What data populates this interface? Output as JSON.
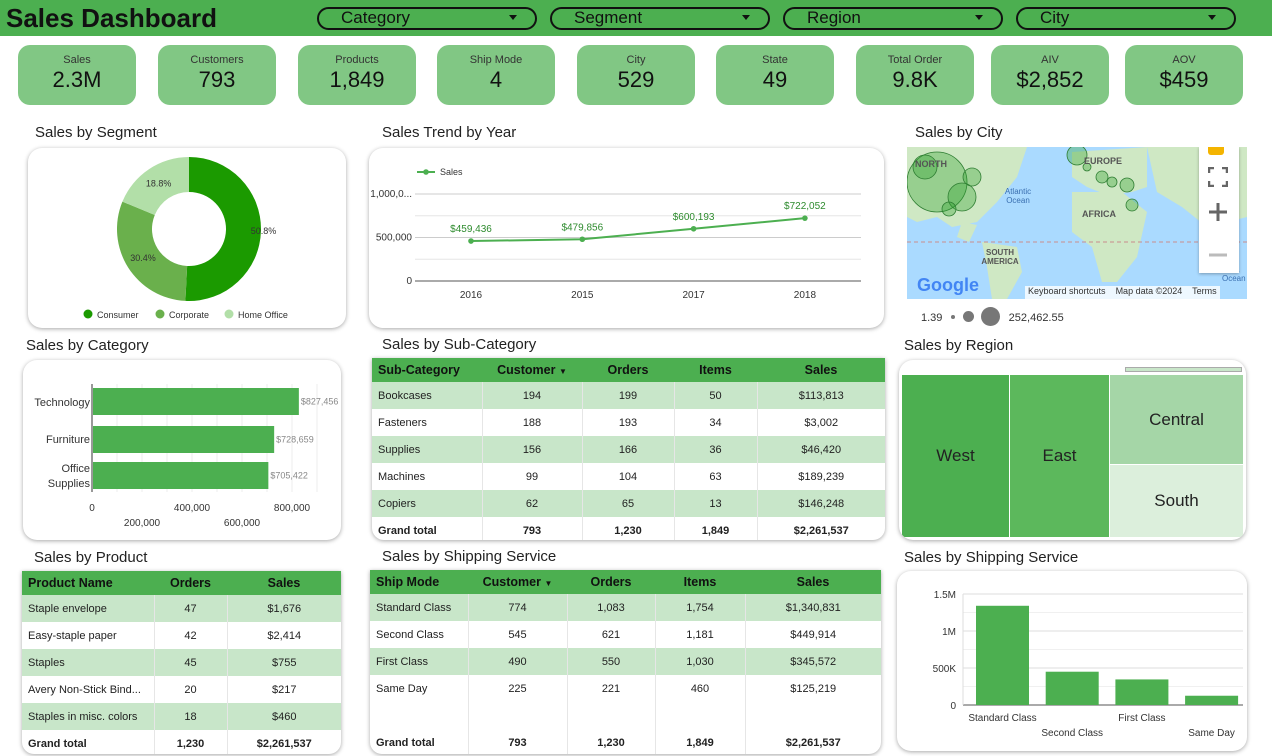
{
  "header": {
    "title": "Sales Dashboard",
    "filters": [
      "Category",
      "Segment",
      "Region",
      "City"
    ]
  },
  "kpis": [
    {
      "label": "Sales",
      "value": "2.3M"
    },
    {
      "label": "Customers",
      "value": "793"
    },
    {
      "label": "Products",
      "value": "1,849"
    },
    {
      "label": "Ship Mode",
      "value": "4"
    },
    {
      "label": "City",
      "value": "529"
    },
    {
      "label": "State",
      "value": "49"
    },
    {
      "label": "Total Order",
      "value": "9.8K"
    },
    {
      "label": "AIV",
      "value": "$2,852"
    },
    {
      "label": "AOV",
      "value": "$459"
    }
  ],
  "titles": {
    "segment": "Sales by Segment",
    "trend": "Sales Trend by Year",
    "city": "Sales by City",
    "category": "Sales by Category",
    "subcategory": "Sales by Sub-Category",
    "region": "Sales by Region",
    "product": "Sales by Product",
    "shipping_table": "Sales by Shipping Service",
    "shipping_chart": "Sales by Shipping Service"
  },
  "colors": {
    "header": "#4caf50",
    "kpi": "#81c784",
    "dark_green": "#1b9a00",
    "mid_green": "#6ab04c",
    "light_green": "#b2dfa8",
    "bar_green": "#4caf50",
    "table_shade": "#c8e6c9"
  },
  "segment_chart": {
    "chart_data": {
      "type": "pie",
      "categories": [
        "Consumer",
        "Corporate",
        "Home Office"
      ],
      "values": [
        50.8,
        30.4,
        18.8
      ],
      "labels": [
        "50.8%",
        "30.4%",
        "18.8%"
      ],
      "legend": "bottom"
    }
  },
  "trend_chart": {
    "chart_data": {
      "type": "line",
      "categories": [
        "2016",
        "2015",
        "2017",
        "2018"
      ],
      "series": [
        {
          "name": "Sales",
          "values": [
            459436,
            479856,
            600193,
            722052
          ]
        }
      ],
      "data_labels": [
        "$459,436",
        "$479,856",
        "$600,193",
        "$722,052"
      ],
      "y_ticks": [
        "0",
        "500,000",
        "1,000,0..."
      ],
      "ylim": [
        0,
        1000000
      ],
      "legend": "top-left"
    }
  },
  "city_map": {
    "labels": [
      "NORTH",
      "EUROPE",
      "Atlantic Ocean",
      "AFRICA",
      "SOUTH AMERICA",
      "India Ocean"
    ],
    "footer": [
      "Keyboard shortcuts",
      "Map data ©2024",
      "Terms"
    ],
    "logo": "Google",
    "size_legend": {
      "min": "1.39",
      "max": "252,462.55"
    }
  },
  "category_chart": {
    "chart_data": {
      "type": "bar",
      "orientation": "horizontal",
      "categories": [
        "Technology",
        "Furniture",
        "Office Supplies"
      ],
      "values": [
        827456,
        728659,
        705422
      ],
      "data_labels": [
        "$827,456",
        "$728,659",
        "$705,422"
      ],
      "x_ticks_top": [
        "0",
        "400,000",
        "800,000"
      ],
      "x_ticks_bottom": [
        "200,000",
        "600,000"
      ],
      "xlim": [
        0,
        900000
      ]
    }
  },
  "subcategory_table": {
    "headers": [
      "Sub-Category",
      "Customer",
      "Orders",
      "Items",
      "Sales"
    ],
    "rows": [
      [
        "Bookcases",
        "194",
        "199",
        "50",
        "$113,813"
      ],
      [
        "Fasteners",
        "188",
        "193",
        "34",
        "$3,002"
      ],
      [
        "Supplies",
        "156",
        "166",
        "36",
        "$46,420"
      ],
      [
        "Machines",
        "99",
        "104",
        "63",
        "$189,239"
      ],
      [
        "Copiers",
        "62",
        "65",
        "13",
        "$146,248"
      ]
    ],
    "total": [
      "Grand total",
      "793",
      "1,230",
      "1,849",
      "$2,261,537"
    ]
  },
  "region_treemap": {
    "chart_data": {
      "type": "treemap",
      "categories": [
        "West",
        "East",
        "Central",
        "South"
      ]
    }
  },
  "product_table": {
    "headers": [
      "Product Name",
      "Orders",
      "Sales"
    ],
    "rows": [
      [
        "Staple envelope",
        "47",
        "$1,676"
      ],
      [
        "Easy-staple paper",
        "42",
        "$2,414"
      ],
      [
        "Staples",
        "45",
        "$755"
      ],
      [
        "Avery Non-Stick Bind...",
        "20",
        "$217"
      ],
      [
        "Staples in misc. colors",
        "18",
        "$460"
      ]
    ],
    "total": [
      "Grand total",
      "1,230",
      "$2,261,537"
    ]
  },
  "shipping_table": {
    "headers": [
      "Ship Mode",
      "Customer",
      "Orders",
      "Items",
      "Sales"
    ],
    "rows": [
      [
        "Standard Class",
        "774",
        "1,083",
        "1,754",
        "$1,340,831"
      ],
      [
        "Second Class",
        "545",
        "621",
        "1,181",
        "$449,914"
      ],
      [
        "First Class",
        "490",
        "550",
        "1,030",
        "$345,572"
      ],
      [
        "Same Day",
        "225",
        "221",
        "460",
        "$125,219"
      ]
    ],
    "total": [
      "Grand total",
      "793",
      "1,230",
      "1,849",
      "$2,261,537"
    ]
  },
  "shipping_chart": {
    "chart_data": {
      "type": "bar",
      "categories": [
        "Standard Class",
        "Second Class",
        "First Class",
        "Same Day"
      ],
      "values": [
        1340831,
        449914,
        345572,
        125219
      ],
      "y_ticks": [
        "0",
        "500K",
        "1M",
        "1.5M"
      ],
      "ylim": [
        0,
        1500000
      ]
    }
  }
}
